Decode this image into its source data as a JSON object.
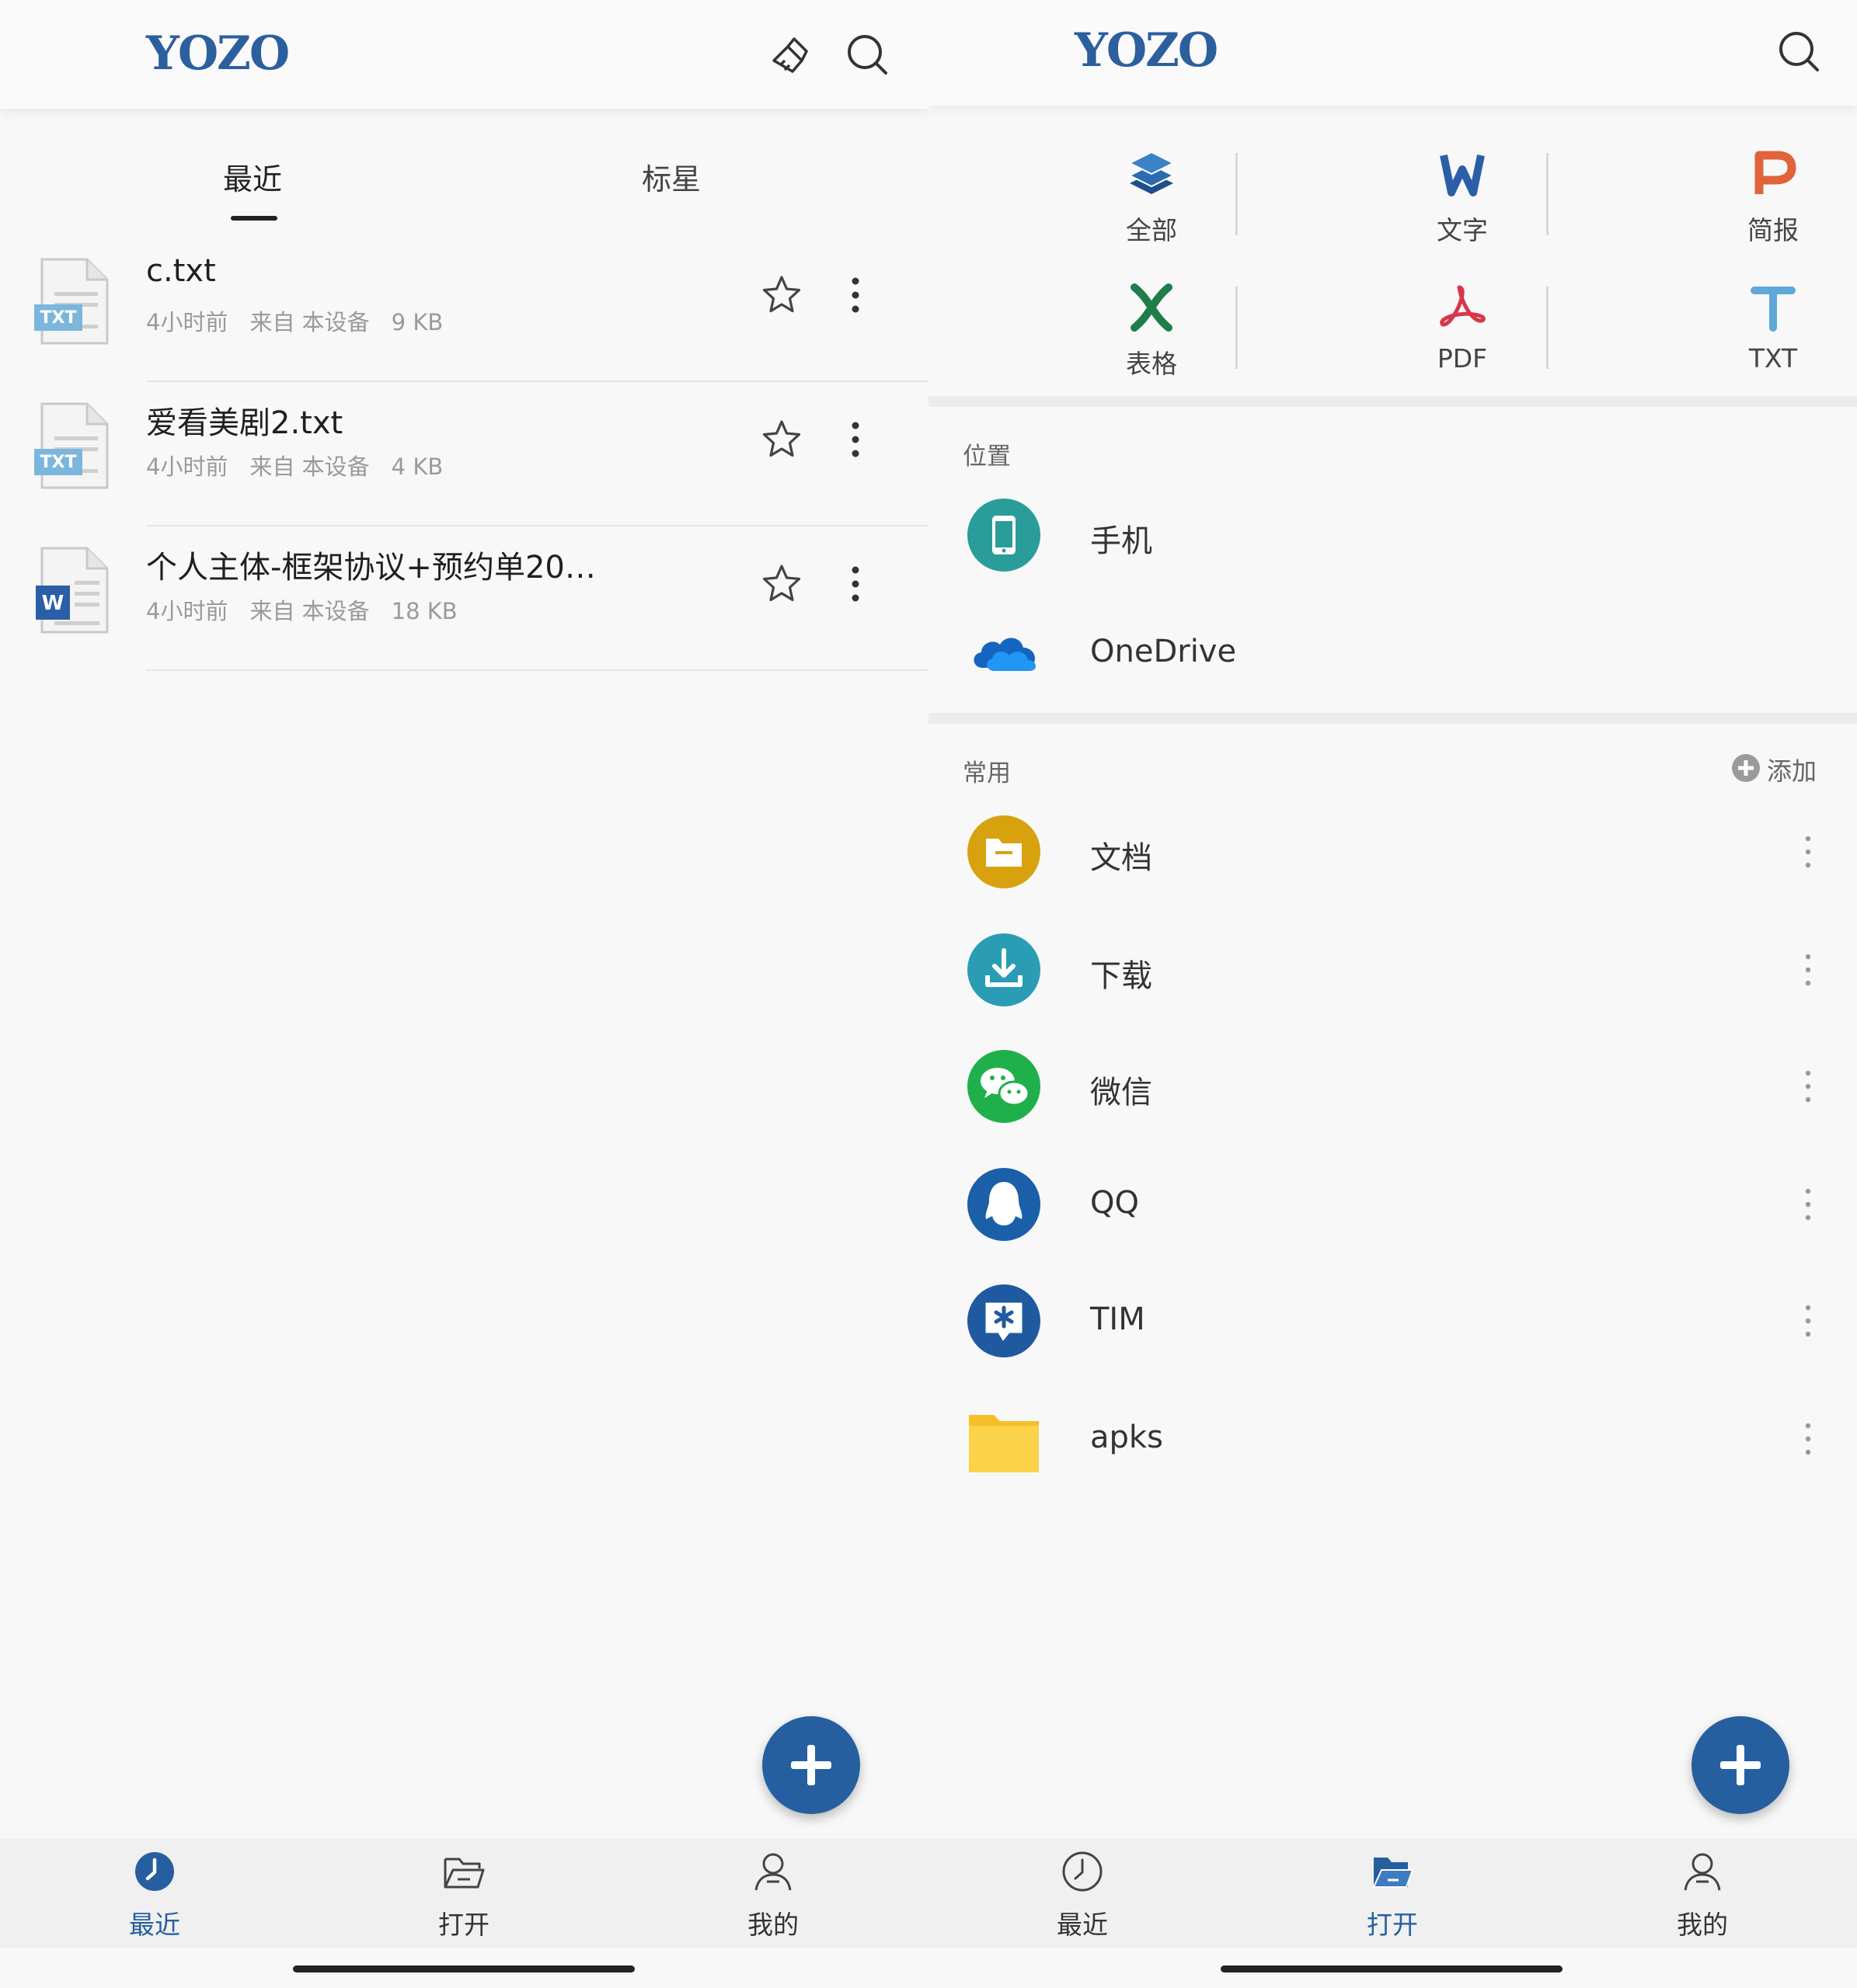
{
  "left": {
    "brand": "YOZO",
    "tabs": [
      {
        "label": "最近",
        "active": true
      },
      {
        "label": "标星",
        "active": false
      }
    ],
    "files": [
      {
        "name": "c.txt",
        "time": "4小时前",
        "source": "来自 本设备",
        "size": "9 KB",
        "type_badge": "TXT",
        "icon": "txt-file-icon"
      },
      {
        "name": "爱看美剧2.txt",
        "time": "4小时前",
        "source": "来自 本设备",
        "size": "4 KB",
        "type_badge": "TXT",
        "icon": "txt-file-icon"
      },
      {
        "name": "个人主体-框架协议+预约单20…",
        "time": "4小时前",
        "source": "来自 本设备",
        "size": "18 KB",
        "type_badge": "W",
        "icon": "word-file-icon"
      }
    ],
    "nav": [
      {
        "label": "最近",
        "icon": "clock-icon",
        "active": true
      },
      {
        "label": "打开",
        "icon": "folder-open-icon",
        "active": false
      },
      {
        "label": "我的",
        "icon": "user-icon",
        "active": false
      }
    ]
  },
  "right": {
    "brand": "YOZO",
    "categories": [
      {
        "label": "全部",
        "icon": "layers-icon"
      },
      {
        "label": "文字",
        "icon": "word-w-icon"
      },
      {
        "label": "简报",
        "icon": "presentation-p-icon"
      },
      {
        "label": "表格",
        "icon": "spreadsheet-x-icon"
      },
      {
        "label": "PDF",
        "icon": "pdf-icon"
      },
      {
        "label": "TXT",
        "icon": "txt-t-icon"
      }
    ],
    "location_title": "位置",
    "locations": [
      {
        "label": "手机",
        "icon": "phone-icon"
      },
      {
        "label": "OneDrive",
        "icon": "onedrive-cloud-icon"
      }
    ],
    "common_title": "常用",
    "add_label": "添加",
    "common": [
      {
        "label": "文档",
        "icon": "documents-folder-icon"
      },
      {
        "label": "下载",
        "icon": "download-icon"
      },
      {
        "label": "微信",
        "icon": "wechat-icon"
      },
      {
        "label": "QQ",
        "icon": "qq-icon"
      },
      {
        "label": "TIM",
        "icon": "tim-icon"
      },
      {
        "label": "apks",
        "icon": "yellow-folder-icon"
      }
    ],
    "nav": [
      {
        "label": "最近",
        "icon": "clock-icon",
        "active": false
      },
      {
        "label": "打开",
        "icon": "folder-open-icon",
        "active": true
      },
      {
        "label": "我的",
        "icon": "user-icon",
        "active": false
      }
    ]
  },
  "colors": {
    "brand_blue": "#265f9f",
    "background": "#f8f8f8",
    "secondary_text": "#9a9a9a"
  }
}
